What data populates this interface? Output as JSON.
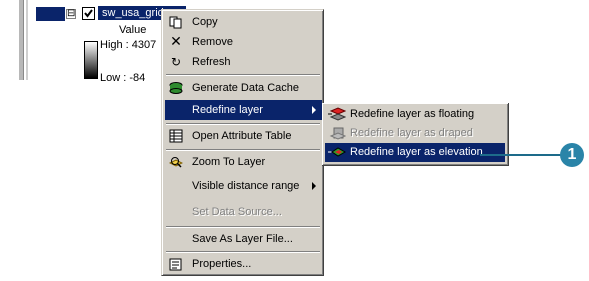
{
  "toc": {
    "expand_glyph": "⊟",
    "layer_name": "sw_usa_grid",
    "legend_title": "Value",
    "high_label": "High : 4307",
    "low_label": "Low : -84"
  },
  "context_menu": {
    "items": [
      {
        "label": "Copy",
        "icon": "copy-icon"
      },
      {
        "label": "Remove",
        "icon": "remove-x-icon"
      },
      {
        "label": "Refresh",
        "icon": "refresh-icon"
      },
      {
        "label": "Generate Data Cache",
        "icon": "data-cache-icon"
      },
      {
        "label": "Redefine layer",
        "icon": "",
        "highlighted": true,
        "submenu": true
      },
      {
        "label": "Open Attribute Table",
        "icon": "attribute-table-icon"
      },
      {
        "label": "Zoom To Layer",
        "icon": "zoom-to-layer-icon"
      },
      {
        "label": "Visible distance range",
        "icon": "",
        "submenu": true
      },
      {
        "label": "Set Data Source...",
        "icon": "",
        "disabled": true
      },
      {
        "label": "Save As Layer File...",
        "icon": ""
      },
      {
        "label": "Properties...",
        "icon": "properties-icon"
      }
    ]
  },
  "submenu": {
    "items": [
      {
        "label": "Redefine layer as floating",
        "icon": "floating-layer-icon"
      },
      {
        "label": "Redefine layer as draped",
        "icon": "draped-layer-icon",
        "disabled": true
      },
      {
        "label": "Redefine layer as elevation",
        "icon": "elevation-layer-icon",
        "highlighted": true
      }
    ]
  },
  "callout": {
    "number": "1",
    "color": "#2a84a8"
  },
  "colors": {
    "highlight": "#0a246a",
    "menu_bg": "#d4d0c8"
  }
}
